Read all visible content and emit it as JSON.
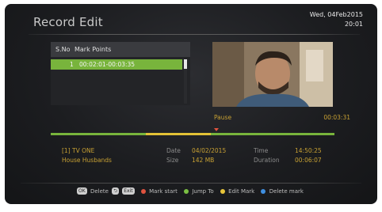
{
  "header": {
    "title": "Record Edit",
    "date": "Wed, 04Feb2015",
    "time": "20:01"
  },
  "mark_list": {
    "headers": [
      "S.No",
      "Mark Points"
    ],
    "rows": [
      {
        "sno": "1",
        "range": "00:02:01-00:03:35"
      }
    ]
  },
  "playback": {
    "status": "Pause",
    "position": "00:03:31"
  },
  "recording": {
    "channel": "[1]  TV ONE",
    "programme": "House Husbands",
    "date_label": "Date",
    "date_value": "04/02/2015",
    "size_label": "Size",
    "size_value": "142 MB",
    "time_label": "Time",
    "time_value": "14:50:25",
    "duration_label": "Duration",
    "duration_value": "00:06:07"
  },
  "footer": {
    "ok_key": "OK",
    "delete_label": "Delete",
    "back_key": "⮌",
    "exit_key": "Exit",
    "mark_start": "Mark start",
    "jump_to": "Jump To",
    "edit_mark": "Edit Mark",
    "delete_mark": "Delete mark"
  },
  "colors": {
    "accent_green": "#78b43c",
    "accent_gold": "#c7a033",
    "red": "#e0533f",
    "green": "#7bc043",
    "yellow": "#e8c53a",
    "blue": "#3f8fe0"
  },
  "icons": [
    "ok-key-icon",
    "back-key-icon",
    "exit-key-icon",
    "red-dot-icon",
    "green-dot-icon",
    "yellow-dot-icon",
    "blue-dot-icon",
    "position-marker-icon"
  ]
}
